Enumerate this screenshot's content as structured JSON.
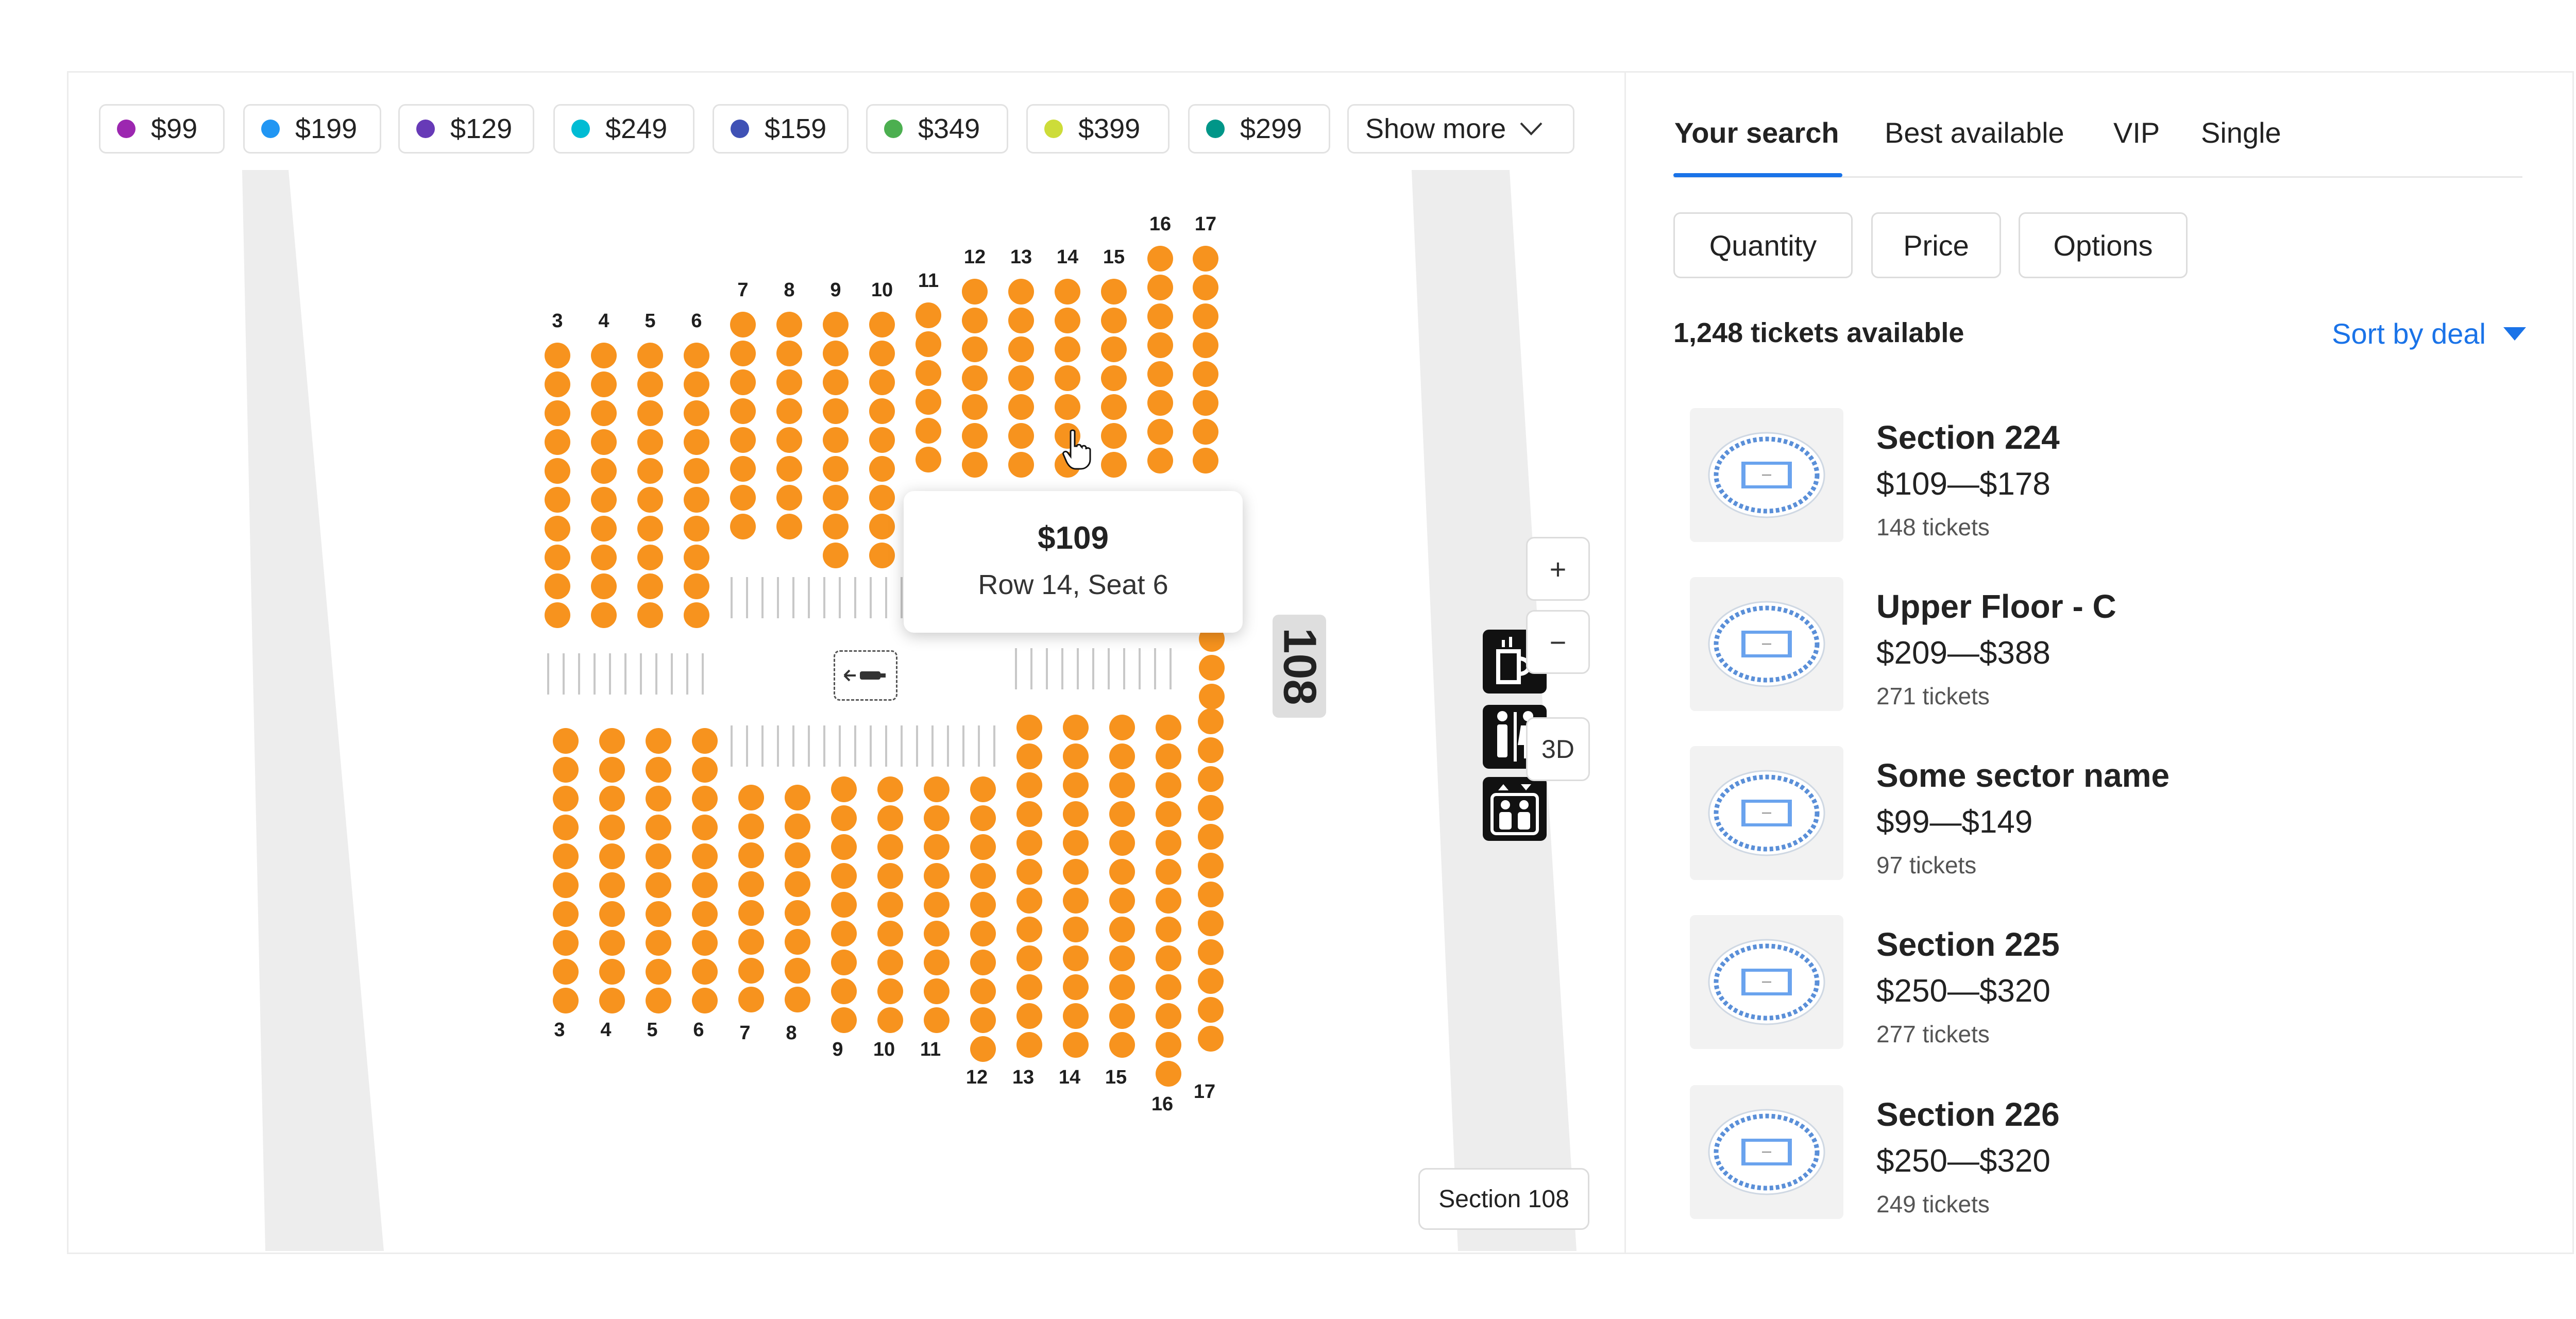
{
  "price_filters": [
    {
      "label": "$99",
      "color": "#9c27b0"
    },
    {
      "label": "$199",
      "color": "#2196f3"
    },
    {
      "label": "$129",
      "color": "#673ab7"
    },
    {
      "label": "$249",
      "color": "#00bcd4"
    },
    {
      "label": "$159",
      "color": "#3f51b5"
    },
    {
      "label": "$349",
      "color": "#4caf50"
    },
    {
      "label": "$399",
      "color": "#cddc39"
    },
    {
      "label": "$299",
      "color": "#009688"
    }
  ],
  "show_more_label": "Show more",
  "map": {
    "section_number": "108",
    "section_label": "Section 108",
    "seat_color": "#f7931e",
    "upper_row_numbers": [
      "3",
      "4",
      "5",
      "6",
      "7",
      "8",
      "9",
      "10",
      "11",
      "12",
      "13",
      "14",
      "15",
      "16",
      "17"
    ],
    "lower_row_numbers": [
      "3",
      "4",
      "5",
      "6",
      "7",
      "8",
      "9",
      "10",
      "11",
      "12",
      "13",
      "14",
      "15",
      "16",
      "17"
    ],
    "tooltip": {
      "price": "$109",
      "seat": "Row 14, Seat 6"
    },
    "controls": {
      "zoom_in": "+",
      "zoom_out": "−",
      "view_3d": "3D"
    }
  },
  "panel": {
    "tabs": [
      "Your search",
      "Best available",
      "VIP",
      "Single"
    ],
    "active_tab": "Your search",
    "filters": [
      "Quantity",
      "Price",
      "Options"
    ],
    "tickets_available": "1,248 tickets available",
    "sort_label": "Sort by deal",
    "accent_color": "#1a73e8",
    "listings": [
      {
        "name": "Section 224",
        "range": "$109—$178",
        "count": "148 tickets"
      },
      {
        "name": "Upper Floor - C",
        "range": "$209—$388",
        "count": "271 tickets"
      },
      {
        "name": "Some sector name",
        "range": "$99—$149",
        "count": "97 tickets"
      },
      {
        "name": "Section 225",
        "range": "$250—$320",
        "count": "277 tickets"
      },
      {
        "name": "Section 226",
        "range": "$250—$320",
        "count": "249 tickets"
      }
    ]
  }
}
